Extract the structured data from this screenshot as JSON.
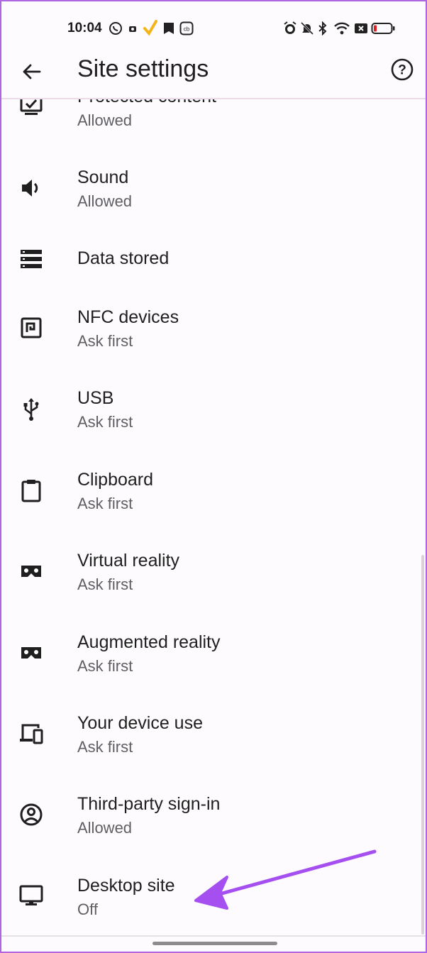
{
  "status_bar": {
    "time": "10:04",
    "left_icons": [
      "whatsapp-icon",
      "notification-icon",
      "check-icon",
      "app-icon",
      "cb-app-icon"
    ],
    "right_icons": [
      "alarm-icon",
      "mute-icon",
      "bluetooth-icon",
      "wifi-icon",
      "close-box-icon",
      "battery-icon"
    ],
    "cb_text": "cb",
    "battery_color": "#e02020"
  },
  "appbar": {
    "title": "Site settings",
    "back_icon": "back-arrow-icon",
    "help_icon": "help-icon",
    "help_glyph": "?"
  },
  "items": [
    {
      "label": "Protected content",
      "sub": "Allowed",
      "icon": "protected-content-icon"
    },
    {
      "label": "Sound",
      "sub": "Allowed",
      "icon": "sound-icon"
    },
    {
      "label": "Data stored",
      "sub": "",
      "icon": "data-stored-icon"
    },
    {
      "label": "NFC devices",
      "sub": "Ask first",
      "icon": "nfc-icon"
    },
    {
      "label": "USB",
      "sub": "Ask first",
      "icon": "usb-icon"
    },
    {
      "label": "Clipboard",
      "sub": "Ask first",
      "icon": "clipboard-icon"
    },
    {
      "label": "Virtual reality",
      "sub": "Ask first",
      "icon": "vr-headset-icon"
    },
    {
      "label": "Augmented reality",
      "sub": "Ask first",
      "icon": "ar-headset-icon"
    },
    {
      "label": "Your device use",
      "sub": "Ask first",
      "icon": "devices-icon"
    },
    {
      "label": "Third-party sign-in",
      "sub": "Allowed",
      "icon": "account-circle-icon"
    },
    {
      "label": "Desktop site",
      "sub": "Off",
      "icon": "desktop-icon"
    }
  ],
  "annotation": {
    "icon": "pointer-arrow-icon",
    "color": "#a64ff0"
  }
}
